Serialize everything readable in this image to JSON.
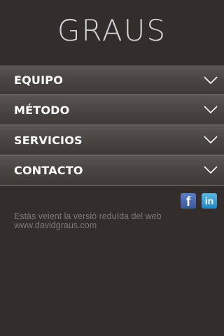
{
  "header": {
    "logo": "GRAUS"
  },
  "menu": {
    "items": [
      {
        "label": "EQUIPO"
      },
      {
        "label": "MÉTODO"
      },
      {
        "label": "SERVICIOS"
      },
      {
        "label": "CONTACTO"
      }
    ]
  },
  "social": {
    "facebook_glyph": "f",
    "linkedin_glyph": "in"
  },
  "footer": {
    "line1": "Estàs veient la versió reduïda del web",
    "line2": "www.davidgraus.com"
  },
  "colors": {
    "background": "#332e2c",
    "menu_text": "#ffffff",
    "footer_text": "#7d7977",
    "facebook": "#3b5998",
    "linkedin": "#1f87c5"
  },
  "icons": {
    "menu_chevron": "chevron-down-icon",
    "facebook": "facebook-icon",
    "linkedin": "linkedin-icon"
  }
}
